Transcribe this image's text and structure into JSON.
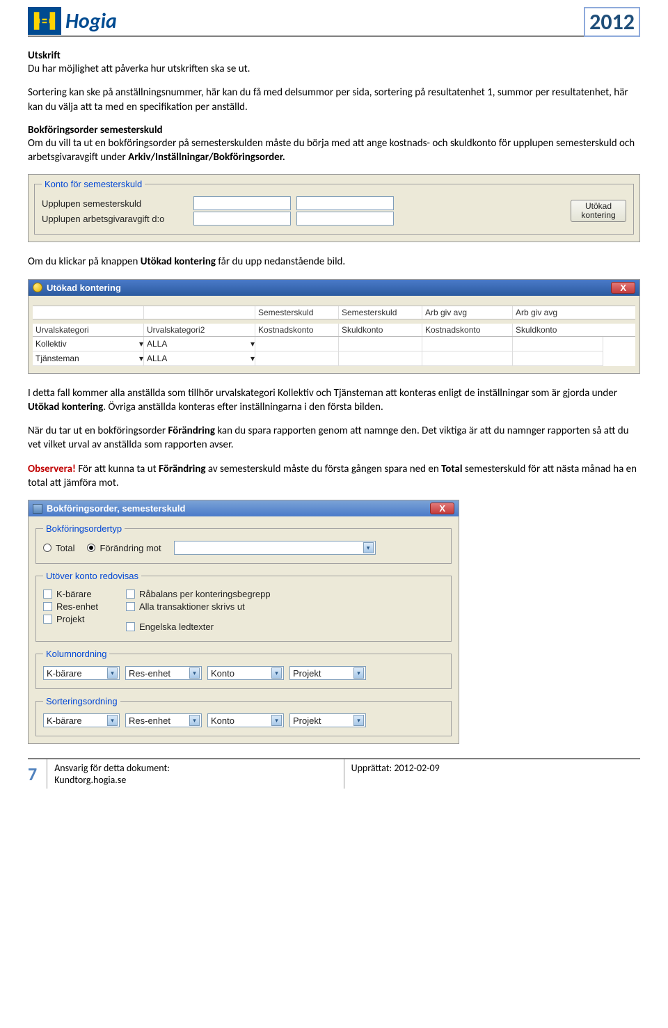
{
  "header": {
    "logo_text": "Hogia",
    "year": "2012"
  },
  "sections": {
    "utskrift_title": "Utskrift",
    "utskrift_p1": "Du har möjlighet att påverka hur utskriften ska se ut.",
    "utskrift_p2": "Sortering kan ske på anställningsnummer, här kan du få med delsummor per sida, sortering på resultatenhet 1, summor per resultatenhet, här kan du välja att ta med en specifikation per anställd.",
    "bokf_title": "Bokföringsorder semesterskuld",
    "bokf_p1a": "Om du vill ta ut en bokföringsorder på semesterskulden måste du börja med att ange kostnads- och skuldkonto för upplupen semesterskuld och arbetsgivaravgift under ",
    "bokf_p1b": "Arkiv/Inställningar/Bokföringsorder.",
    "mid_p1a": "Om du klickar på knappen ",
    "mid_p1b": "Utökad kontering",
    "mid_p1c": " får du upp nedanstående bild.",
    "after2_p1a": "I detta fall kommer alla anställda som tillhör urvalskategori Kollektiv och Tjänsteman att konteras enligt de inställningar som är gjorda under ",
    "after2_p1b": "Utökad kontering",
    "after2_p1c": ". Övriga anställda konteras efter inställningarna i den första bilden.",
    "after2_p2a": "När du tar ut en bokföringsorder ",
    "after2_p2b": "Förändring",
    "after2_p2c": " kan du spara rapporten genom att namnge den. Det viktiga är att du namnger rapporten så att du vet vilket urval av anställda som rapporten avser.",
    "after2_p3a": "Observera!",
    "after2_p3b": " För att kunna ta ut ",
    "after2_p3c": "Förändring",
    "after2_p3d": " av semesterskuld måste du första gången spara ned en ",
    "after2_p3e": "Total",
    "after2_p3f": " semesterskuld för att nästa månad ha en total att jämföra mot."
  },
  "panel1": {
    "legend": "Konto för semesterskuld",
    "row1": "Upplupen semesterskuld",
    "row2": "Upplupen arbetsgivaravgift d:o",
    "button": "Utökad kontering"
  },
  "panel2": {
    "title": "Utökad kontering",
    "hdr": [
      "Urvalskategori",
      "Urvalskategori2",
      "Semesterskuld Kostnadskonto",
      "Semesterskuld Skuldkonto",
      "Arb giv avg Kostnadskonto",
      "Arb giv avg Skuldkonto"
    ],
    "row1_cat": "Kollektiv",
    "row1_cat2": "ALLA",
    "row2_cat": "Tjänsteman",
    "row2_cat2": "ALLA"
  },
  "panel3": {
    "title": "Bokföringsorder, semesterskuld",
    "fs_type": "Bokföringsordertyp",
    "radio_total": "Total",
    "radio_forandring": "Förändring mot",
    "fs_utover": "Utöver konto redovisas",
    "cb_kbarare": "K-bärare",
    "cb_res": "Res-enhet",
    "cb_projekt": "Projekt",
    "cb_rabalans": "Råbalans per konteringsbegrepp",
    "cb_alla": "Alla transaktioner skrivs ut",
    "cb_eng": "Engelska ledtexter",
    "fs_kolumn": "Kolumnordning",
    "fs_sort": "Sorteringsordning",
    "opts": [
      "K-bärare",
      "Res-enhet",
      "Konto",
      "Projekt"
    ]
  },
  "footer": {
    "page": "7",
    "left1": "Ansvarig för detta dokument:",
    "left2": "Kundtorg.hogia.se",
    "right": "Upprättat: 2012-02-09"
  }
}
